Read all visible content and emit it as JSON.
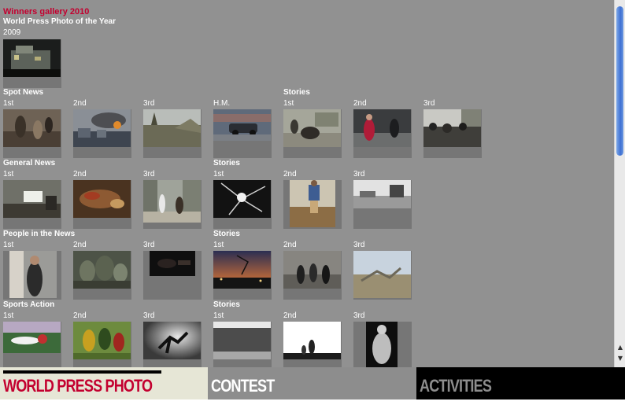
{
  "gallery": {
    "title": "Winners gallery 2010",
    "poy_heading": "World Press Photo of the Year",
    "poy_year": "2009"
  },
  "sections": [
    {
      "name": "Spot News",
      "singles_labels": [
        "1st",
        "2nd",
        "3rd",
        "H.M."
      ],
      "stories_heading": "Stories",
      "stories_labels": [
        "1st",
        "2nd",
        "3rd"
      ]
    },
    {
      "name": "General News",
      "singles_labels": [
        "1st",
        "2nd",
        "3rd"
      ],
      "stories_heading": "Stories",
      "stories_labels": [
        "1st",
        "2nd",
        "3rd"
      ]
    },
    {
      "name": "People in the News",
      "singles_labels": [
        "1st",
        "2nd",
        "3rd"
      ],
      "stories_heading": "Stories",
      "stories_labels": [
        "1st",
        "2nd",
        "3rd"
      ]
    },
    {
      "name": "Sports Action",
      "singles_labels": [
        "1st",
        "2nd",
        "3rd"
      ],
      "stories_heading": "Stories",
      "stories_labels": [
        "1st",
        "2nd",
        "3rd"
      ]
    }
  ],
  "nav": {
    "world_press_photo": "WORLD PRESS PHOTO",
    "contest": "CONTEST",
    "activities": "ACTIVITIES"
  },
  "scrollbar": {
    "up_arrow": "▲",
    "down_arrow": "▼"
  },
  "colors": {
    "background": "#919191",
    "title_red": "#c3002f",
    "nav_wpp_bg": "#e6e6d6",
    "nav_activities_bg": "#000000"
  }
}
